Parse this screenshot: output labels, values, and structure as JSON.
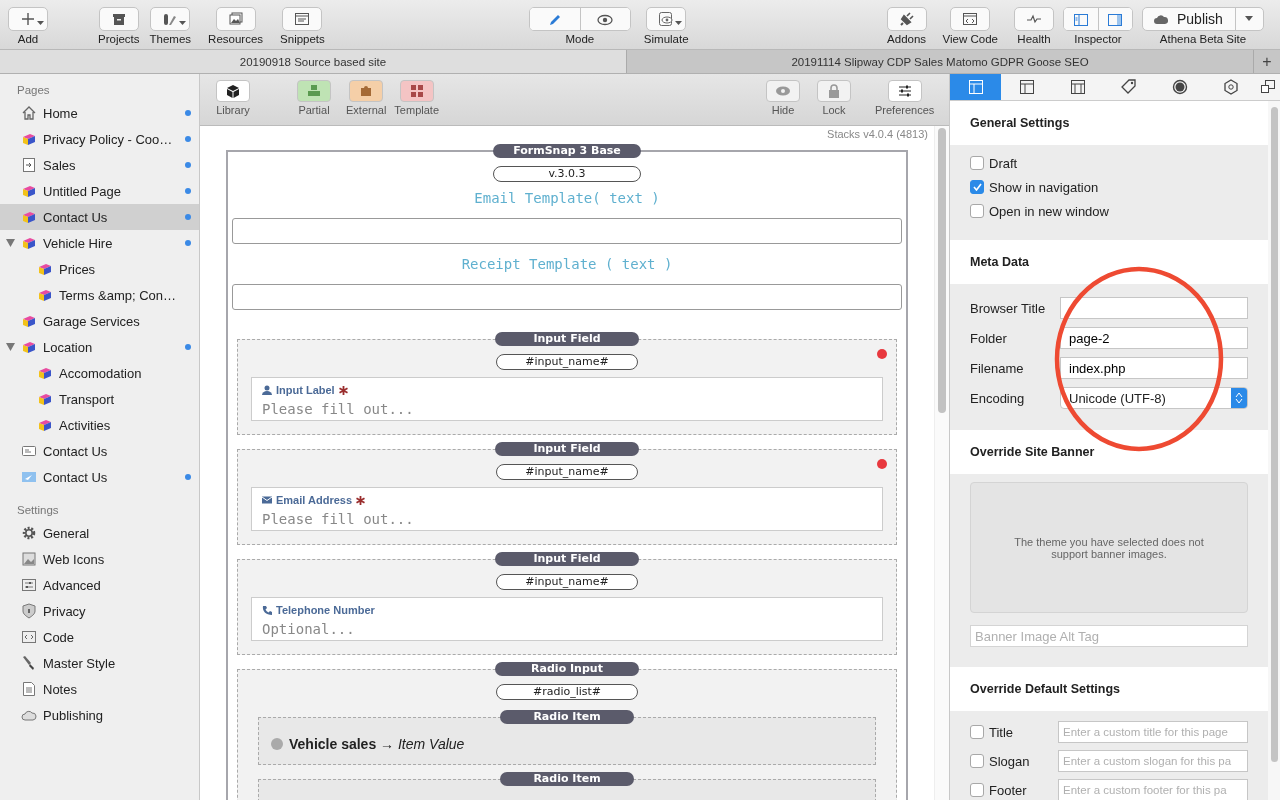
{
  "toolbar": {
    "items": [
      {
        "kind": "add",
        "label": "Add"
      },
      {
        "kind": "projects",
        "label": "Projects"
      },
      {
        "kind": "themes",
        "label": "Themes"
      },
      {
        "kind": "resources",
        "label": "Resources"
      },
      {
        "kind": "snippets",
        "label": "Snippets"
      },
      {
        "kind": "mode",
        "label": "Mode",
        "segments": [
          {
            "kind": "edit",
            "selected": true
          },
          {
            "kind": "preview",
            "selected": false
          }
        ]
      },
      {
        "kind": "simulate",
        "label": "Simulate"
      },
      {
        "kind": "addons",
        "label": "Addons"
      },
      {
        "kind": "view-code",
        "label": "View Code"
      },
      {
        "kind": "health",
        "label": "Health"
      },
      {
        "kind": "inspector",
        "label": "Inspector"
      },
      {
        "kind": "publish",
        "label": "Athena Beta Site",
        "button": "Publish"
      }
    ]
  },
  "tabs": [
    {
      "label": "20190918 Source based site",
      "selected": true
    },
    {
      "label": "20191114 Slipway CDP Sales Matomo GDPR Goose SEO",
      "selected": false
    }
  ],
  "tab_add": "+",
  "sidebar": {
    "pages_heading": "Pages",
    "pages": [
      {
        "label": "Home",
        "kind": "home",
        "modified": true
      },
      {
        "label": "Privacy Policy - Coo…",
        "kind": "stacks",
        "modified": true
      },
      {
        "label": "Sales",
        "kind": "link",
        "modified": true
      },
      {
        "label": "Untitled Page",
        "kind": "stacks",
        "modified": true
      },
      {
        "label": "Contact Us",
        "kind": "stacks",
        "modified": true,
        "selected": true
      },
      {
        "label": "Vehicle Hire",
        "kind": "stacks",
        "modified": true,
        "expanded": true,
        "children": [
          {
            "label": "Prices",
            "kind": "stacks",
            "modified": false
          },
          {
            "label": "Terms &amp; Con…",
            "kind": "stacks",
            "modified": false
          }
        ]
      },
      {
        "label": "Garage Services",
        "kind": "stacks",
        "modified": false
      },
      {
        "label": "Location",
        "kind": "stacks",
        "modified": true,
        "expanded": true,
        "children": [
          {
            "label": "Accomodation",
            "kind": "stacks",
            "modified": false
          },
          {
            "label": "Transport",
            "kind": "stacks",
            "modified": false
          },
          {
            "label": "Activities",
            "kind": "stacks",
            "modified": false
          }
        ]
      },
      {
        "label": "Contact Us",
        "kind": "form",
        "modified": false
      },
      {
        "label": "Contact Us",
        "kind": "mail",
        "modified": true
      }
    ],
    "settings_heading": "Settings",
    "settings": [
      {
        "label": "General",
        "kind": "gear"
      },
      {
        "label": "Web Icons",
        "kind": "image"
      },
      {
        "label": "Advanced",
        "kind": "sliders"
      },
      {
        "label": "Privacy",
        "kind": "shield"
      },
      {
        "label": "Code",
        "kind": "code"
      },
      {
        "label": "Master Style",
        "kind": "brush"
      },
      {
        "label": "Notes",
        "kind": "notes"
      },
      {
        "label": "Publishing",
        "kind": "cloud"
      }
    ]
  },
  "canvas": {
    "toolbar": [
      {
        "kind": "library",
        "label": "Library"
      },
      {
        "kind": "partial",
        "label": "Partial"
      },
      {
        "kind": "external",
        "label": "External"
      },
      {
        "kind": "template",
        "label": "Template"
      },
      {
        "kind": "hide",
        "label": "Hide"
      },
      {
        "kind": "lock",
        "label": "Lock"
      },
      {
        "kind": "preferences",
        "label": "Preferences"
      }
    ],
    "version": "Stacks v4.0.4 (4813)",
    "stack": {
      "badge": "FormSnap 3 Base",
      "pill": "v.3.0.3",
      "email_template": "Email Template( text )",
      "receipt_template": "Receipt Template ( text )",
      "fields": [
        {
          "badge": "Input Field",
          "pill": "#input_name#",
          "label": "Input Label",
          "required": true,
          "placeholder": "Please fill out..."
        },
        {
          "badge": "Input Field",
          "pill": "#input_name#",
          "label": "Email Address",
          "required": true,
          "placeholder": "Please fill out..."
        },
        {
          "badge": "Input Field",
          "pill": "#input_name#",
          "label": "Telephone Number",
          "required": false,
          "placeholder": "Optional..."
        }
      ],
      "radio": {
        "badge": "Radio Input",
        "pill": "#radio_list#",
        "items": [
          {
            "badge": "Radio Item",
            "text": "**Vehicle sales** → *Item Value*",
            "selected": false
          },
          {
            "badge": "Radio Item"
          }
        ]
      }
    }
  },
  "inspector": {
    "tabs": [
      {
        "kind": "page",
        "selected": true
      },
      {
        "kind": "layout",
        "selected": false
      },
      {
        "kind": "header",
        "selected": false
      },
      {
        "kind": "tag",
        "selected": false
      },
      {
        "kind": "circle",
        "selected": false
      },
      {
        "kind": "hexagon",
        "selected": false
      },
      {
        "kind": "window",
        "selected": false
      }
    ],
    "general": {
      "heading": "General Settings",
      "options": [
        {
          "label": "Draft",
          "checked": false
        },
        {
          "label": "Show in navigation",
          "checked": true
        },
        {
          "label": "Open in new window",
          "checked": false
        }
      ]
    },
    "meta": {
      "heading": "Meta Data",
      "fields": [
        {
          "label": "Browser Title",
          "kind": "text"
        },
        {
          "label": "Folder",
          "kind": "text",
          "value": "page-2"
        },
        {
          "label": "Filename",
          "kind": "text",
          "value": "index.php"
        },
        {
          "label": "Encoding",
          "kind": "select",
          "value": "Unicode (UTF-8)"
        }
      ]
    },
    "banner": {
      "heading": "Override Site Banner",
      "message": "The theme you have selected does not support banner images.",
      "alt_placeholder": "Banner Image Alt Tag"
    },
    "defaults": {
      "heading": "Override Default Settings",
      "options": [
        {
          "label": "Title",
          "checked": false,
          "placeholder": "Enter a custom title for this page"
        },
        {
          "label": "Slogan",
          "checked": false,
          "placeholder": "Enter a custom slogan for this pa"
        },
        {
          "label": "Footer",
          "checked": false,
          "placeholder": "Enter a custom footer for this pa"
        }
      ]
    }
  }
}
